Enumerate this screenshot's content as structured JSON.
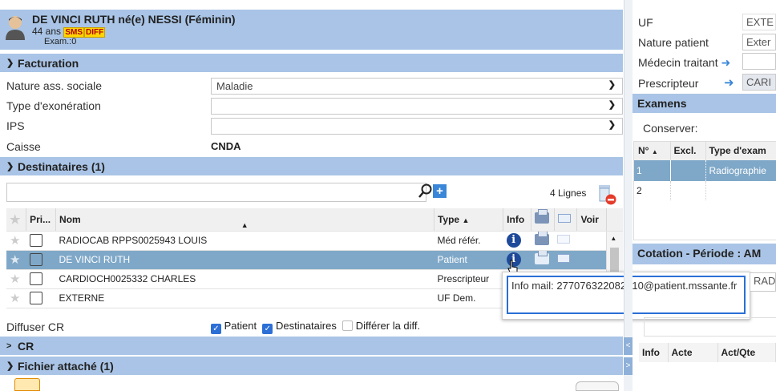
{
  "patient": {
    "name": "DE VINCI RUTH né(e) NESSI (Féminin)",
    "age": "44 ans",
    "badge_sms": "SMS",
    "badge_diff": "DIFF",
    "exam": "Exam.:0"
  },
  "facturation": {
    "title": "Facturation",
    "fields": [
      {
        "label": "Nature ass. sociale",
        "value": "Maladie"
      },
      {
        "label": "Type d'exonération",
        "value": ""
      },
      {
        "label": "IPS",
        "value": ""
      }
    ],
    "caisse_label": "Caisse",
    "caisse_value": "CNDA"
  },
  "destinataires": {
    "title": "Destinataires (1)",
    "count": "4 Lignes",
    "columns": {
      "pri": "Pri...",
      "nom": "Nom",
      "type": "Type",
      "info": "Info",
      "voir": "Voir"
    },
    "rows": [
      {
        "nom": "RADIOCAB RPPS0025943 LOUIS",
        "type": "Méd référ."
      },
      {
        "nom": "DE VINCI RUTH",
        "type": "Patient"
      },
      {
        "nom": "CARDIOCH0025332 CHARLES",
        "type": "Prescripteur"
      },
      {
        "nom": "EXTERNE",
        "type": "UF Dem."
      }
    ],
    "tooltip": "Info mail: 277076322082910@patient.mssante.fr"
  },
  "diffuser": {
    "label": "Diffuser CR",
    "patient": "Patient",
    "destinataires": "Destinataires",
    "differer": "Différer la diff."
  },
  "cr": {
    "title": "CR"
  },
  "fichier": {
    "title": "Fichier attaché (1)"
  },
  "right_panel": {
    "fields": [
      {
        "label": "UF",
        "value": "EXTE"
      },
      {
        "label": "Nature patient",
        "value": "Exter"
      },
      {
        "label": "Médecin traitant",
        "value": ""
      },
      {
        "label": "Prescripteur",
        "value": "CARI"
      }
    ],
    "examens_title": "Examens",
    "conserver": "Conserver:",
    "exam_columns": {
      "n": "N°",
      "excl": "Excl.",
      "type": "Type d'exam"
    },
    "exam_rows": [
      {
        "n": "1",
        "type": "Radiographie"
      },
      {
        "n": "2",
        "type": ""
      }
    ],
    "cotation_title": "Cotation - Période : AM",
    "cotation_field": "RADI",
    "cot_columns": {
      "info": "Info",
      "acte": "Acte",
      "actqte": "Act/Qte"
    }
  },
  "colors": {
    "header": "#a9c4e6",
    "selected_row": "#7fa8c8",
    "badge_yellow": "#ffd400",
    "tooltip_border": "#2a6fd6"
  }
}
